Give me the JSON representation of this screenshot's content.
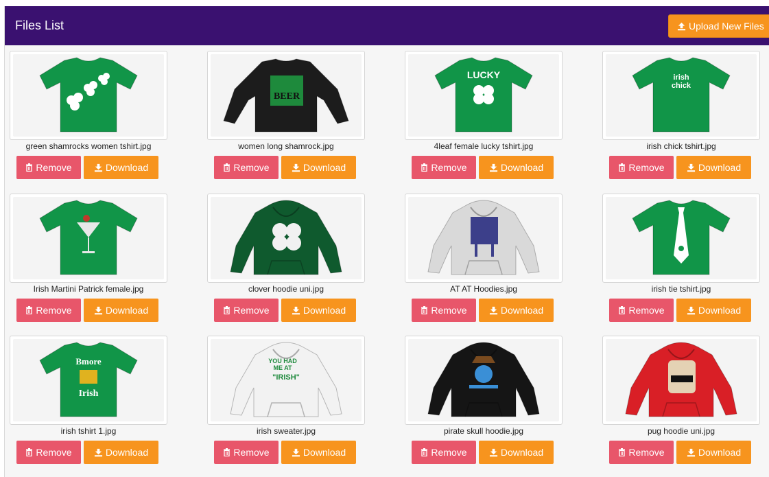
{
  "header": {
    "title": "Files List",
    "upload_label": "Upload New Files"
  },
  "colors": {
    "header_bg": "#3a1170",
    "remove": "#e8566a",
    "download": "#f7941e"
  },
  "labels": {
    "remove": "Remove",
    "download": "Download"
  },
  "files": [
    {
      "name": "green shamrocks women tshirt.jpg",
      "garment": "tshirt",
      "color": "#119548",
      "design": "shamrocks"
    },
    {
      "name": "women long shamrock.jpg",
      "garment": "longsleeve",
      "color": "#1c1c1c",
      "design": "ilovebeer"
    },
    {
      "name": "4leaf female lucky tshirt.jpg",
      "garment": "tshirt",
      "color": "#119548",
      "design": "lucky"
    },
    {
      "name": "irish chick tshirt.jpg",
      "garment": "tshirt",
      "color": "#119548",
      "design": "irishchick"
    },
    {
      "name": "Irish Martini Patrick female.jpg",
      "garment": "tshirt",
      "color": "#119548",
      "design": "martini"
    },
    {
      "name": "clover hoodie uni.jpg",
      "garment": "hoodie",
      "color": "#0f5a2e",
      "design": "clover"
    },
    {
      "name": "AT AT Hoodies.jpg",
      "garment": "hoodie",
      "color": "#d9d9d9",
      "design": "atat"
    },
    {
      "name": "irish tie tshirt.jpg",
      "garment": "tshirt",
      "color": "#119548",
      "design": "tie"
    },
    {
      "name": "irish tshirt 1.jpg",
      "garment": "tshirt",
      "color": "#119548",
      "design": "bmore"
    },
    {
      "name": "irish sweater.jpg",
      "garment": "hoodie",
      "color": "#f2f2f2",
      "design": "youhadme"
    },
    {
      "name": "pirate skull hoodie.jpg",
      "garment": "hoodie",
      "color": "#151515",
      "design": "skull"
    },
    {
      "name": "pug hoodie uni.jpg",
      "garment": "hoodie",
      "color": "#d91f26",
      "design": "pug"
    }
  ]
}
